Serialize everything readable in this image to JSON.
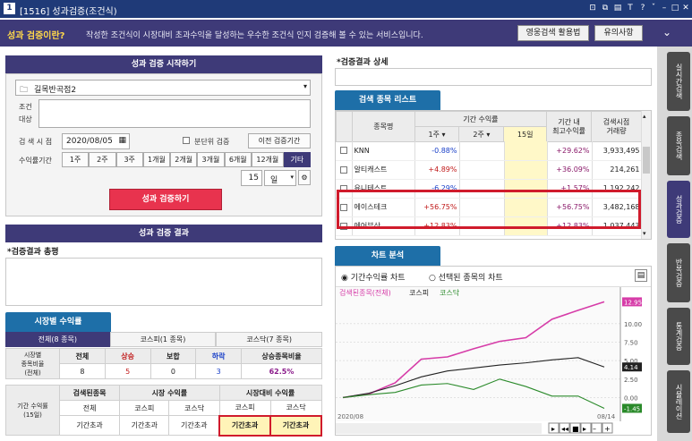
{
  "window": {
    "id": "1516",
    "title": "[1516] 성과검증(조건식)",
    "icon_label": "1"
  },
  "info": {
    "lead": "성과 검증이란?",
    "desc": "작성한 조건식이 시장대비 초과수익을 달성하는 우수한 조건식 인지 검증해 볼 수 있는 서비스입니다.",
    "btn_usage": "영웅검색 활용법",
    "btn_notice": "유의사항"
  },
  "start": {
    "header": "성과 검증 시작하기",
    "selected_condition": "길목반곡점2",
    "cond_label": "조건\n대상",
    "date_label": "검 색 시 점",
    "date": "2020/08/05",
    "minute_label": "분단위 검증",
    "prev_btn": "이전 검증기간",
    "period_label": "수익률기간",
    "periods": [
      "1주",
      "2주",
      "3주",
      "1개월",
      "2개월",
      "3개월",
      "6개월",
      "12개월",
      "기타"
    ],
    "days": "15",
    "unit": "일",
    "run_btn": "성과 검증하기"
  },
  "result": {
    "header": "성과 검증 결과",
    "summary_label": "*검증결과 총평"
  },
  "market": {
    "tab": "시장별 수익률",
    "subtabs": [
      "전체(8 종목)",
      "코스피(1 종목)",
      "코스닥(7 종목)"
    ],
    "ratio_label": "시장별\n종목비율\n(전체)",
    "cols": [
      "전체",
      "상승",
      "보합",
      "하락",
      "상승종목비율"
    ],
    "vals": [
      "8",
      "5",
      "0",
      "3",
      "62.5%"
    ],
    "period_label": "기간 수익률\n(15일)",
    "g_heads": [
      "검색된종목",
      "시장 수익률",
      "시장대비 수익률"
    ],
    "g_sub": [
      "전체",
      "코스피",
      "코스닥",
      "코스피",
      "코스닥"
    ],
    "g_vals": [
      "기간초과",
      "기간초과",
      "기간초과",
      "기간초과",
      "기간초과"
    ]
  },
  "detail": {
    "label": "*검증결과 상세"
  },
  "list": {
    "tab": "검색 종목 리스트",
    "h_name": "종목명",
    "h_period": "기간 수익률",
    "h_w1": "1주",
    "h_w2": "2주",
    "h_d15": "15일",
    "h_max": "기간 내\n최고수익률",
    "h_vol": "검색시점\n거래량",
    "rows": [
      {
        "name": "KNN",
        "w1": "-0.88%",
        "max": "+29.62%",
        "vol": "3,933,495"
      },
      {
        "name": "알티캐스트",
        "w1": "+4.89%",
        "max": "+36.09%",
        "vol": "214,261"
      },
      {
        "name": "유니테스트",
        "w1": "-6.29%",
        "max": "+1.57%",
        "vol": "1,192,242"
      },
      {
        "name": "에이스테크",
        "w1": "+56.75%",
        "max": "+56.75%",
        "vol": "3,482,168"
      },
      {
        "name": "에어부산",
        "w1": "+12.83%",
        "max": "+12.83%",
        "vol": "1,037,443"
      }
    ]
  },
  "chart": {
    "tab": "차트 분석",
    "radio1": "기간수익률 차트",
    "radio2": "선택된 종목의 차트",
    "legend": [
      "검색된종목(전체)",
      "코스피",
      "코스닥"
    ],
    "x_start": "2020/08",
    "x_end": "08/14"
  },
  "chart_data": {
    "type": "line",
    "x": [
      1,
      2,
      3,
      4,
      5,
      6,
      7,
      8,
      9,
      10,
      11
    ],
    "series": [
      {
        "name": "검색된종목(전체)",
        "values": [
          0,
          0.5,
          2,
          5.2,
          5.5,
          6.6,
          7.6,
          8.1,
          10.6,
          11.8,
          12.95
        ]
      },
      {
        "name": "코스피",
        "values": [
          0,
          0.6,
          1.6,
          2.8,
          3.6,
          4,
          4.4,
          4.7,
          5.1,
          5.4,
          4.14
        ]
      },
      {
        "name": "코스닥",
        "values": [
          0,
          0.4,
          0.7,
          1.7,
          1.9,
          1.1,
          2.5,
          1.5,
          0.2,
          0.2,
          -1.45
        ]
      }
    ],
    "ylim": [
      -2,
      13
    ],
    "yticks": [
      "10.00",
      "7.50",
      "5.00",
      "2.50",
      "0.00"
    ],
    "end_labels": [
      "12.95",
      "4.14",
      "-1.45"
    ],
    "colors": [
      "#d63ca8",
      "#222222",
      "#2a8a2a"
    ]
  },
  "sidebar": [
    "실시간검색",
    "종목검색",
    "성과검증",
    "반복검증",
    "통계검증",
    "시뮬레이션"
  ]
}
